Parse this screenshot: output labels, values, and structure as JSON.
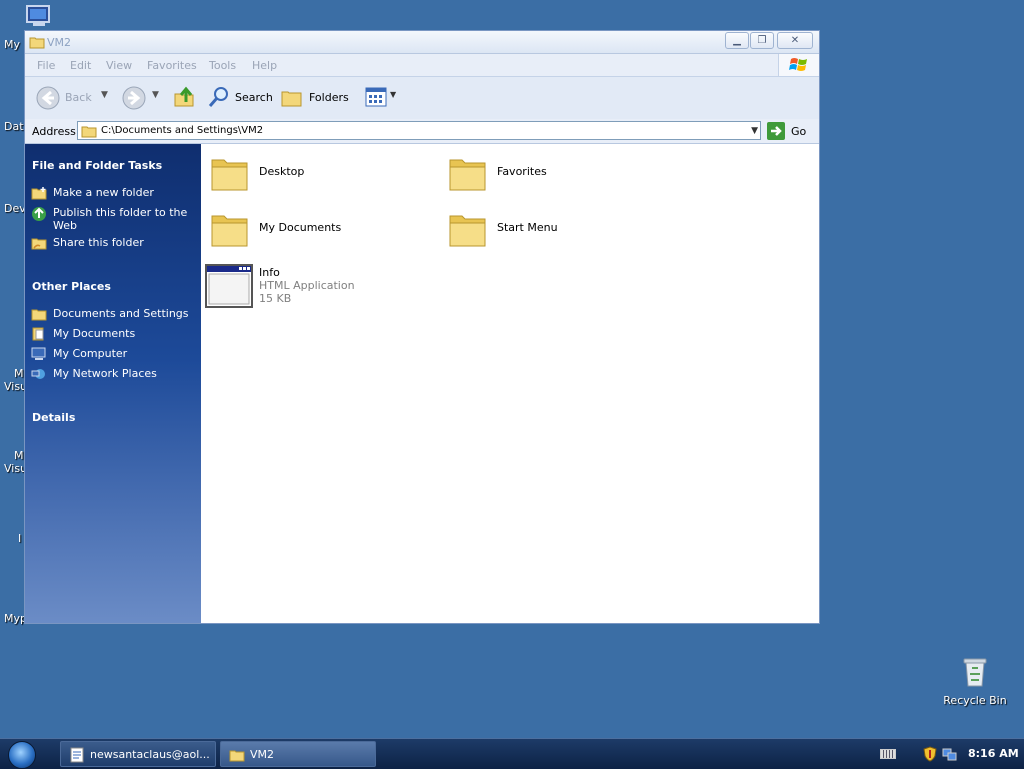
{
  "desktop": {
    "icons": [
      {
        "label": "Recycle Bin"
      }
    ],
    "clipped_labels": [
      "My",
      "Dat",
      "Dev",
      "M",
      "Visu",
      "M",
      "Visu",
      "I",
      "Myp"
    ]
  },
  "window": {
    "title": "VM2",
    "controls": [
      "minimize",
      "restore",
      "close"
    ],
    "menu": [
      "File",
      "Edit",
      "View",
      "Favorites",
      "Tools",
      "Help"
    ],
    "toolbar": {
      "back": "Back",
      "search": "Search",
      "folders": "Folders"
    },
    "address": {
      "label": "Address",
      "value": "C:\\Documents and Settings\\VM2",
      "go": "Go"
    },
    "taskpane": {
      "file_tasks": {
        "heading": "File and Folder Tasks",
        "items": [
          {
            "label": "Make a new folder",
            "icon": "new-folder-icon"
          },
          {
            "label": "Publish this folder to the Web",
            "icon": "publish-web-icon"
          },
          {
            "label": "Share this folder",
            "icon": "share-folder-icon"
          }
        ]
      },
      "other_places": {
        "heading": "Other Places",
        "items": [
          {
            "label": "Documents and Settings",
            "icon": "folder-icon"
          },
          {
            "label": "My Documents",
            "icon": "my-documents-icon"
          },
          {
            "label": "My Computer",
            "icon": "my-computer-icon"
          },
          {
            "label": "My Network Places",
            "icon": "network-places-icon"
          }
        ]
      },
      "details": {
        "heading": "Details"
      }
    },
    "content": {
      "items": [
        {
          "name": "Desktop",
          "type": "folder"
        },
        {
          "name": "Favorites",
          "type": "folder"
        },
        {
          "name": "My Documents",
          "type": "folder"
        },
        {
          "name": "Start Menu",
          "type": "folder"
        },
        {
          "name": "Info",
          "type": "hta",
          "kind": "HTML Application",
          "size": "15 KB"
        }
      ]
    }
  },
  "taskbar": {
    "buttons": [
      {
        "label": "newsantaclaus@aol...",
        "icon": "notepad-icon",
        "active": false
      },
      {
        "label": "VM2",
        "icon": "folder-icon",
        "active": true
      }
    ],
    "clock": "8:16 AM"
  },
  "colors": {
    "desktop": "#3b6ea5",
    "taskpane_top": "#0f2e6f",
    "folder": "#f3d77a"
  }
}
